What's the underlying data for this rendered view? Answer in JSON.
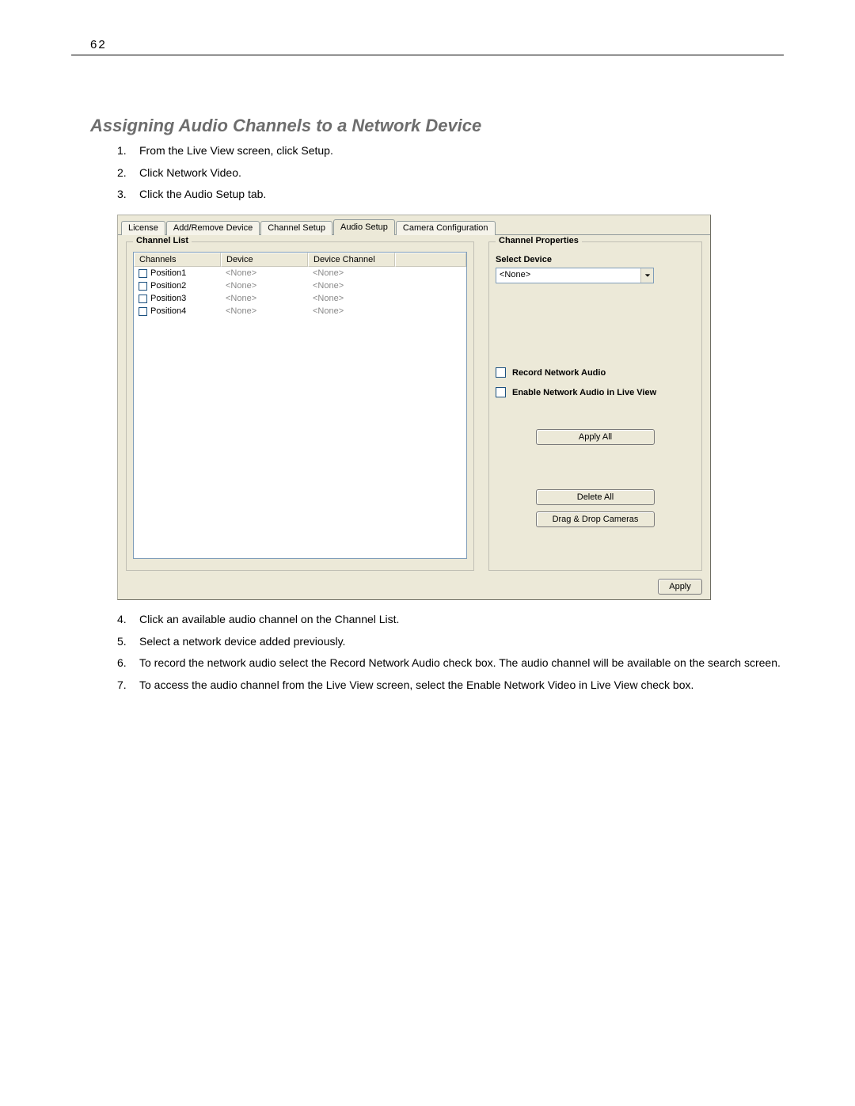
{
  "page_number": "62",
  "section_title": "Assigning Audio Channels to a Network Device",
  "steps_top": [
    "From the Live View screen, click Setup.",
    "Click Network Video.",
    "Click the Audio Setup tab."
  ],
  "steps_bottom": [
    "Click an available audio channel on the Channel List.",
    "Select a network device added previously.",
    "To record the network audio select the Record Network Audio check box. The audio channel will be available on the search screen.",
    "To access the audio channel from the Live View screen, select the Enable Network Video in Live View check box."
  ],
  "dialog": {
    "tabs": [
      "License",
      "Add/Remove Device",
      "Channel Setup",
      "Audio Setup",
      "Camera Configuration"
    ],
    "active_tab_index": 3,
    "channel_list": {
      "legend": "Channel List",
      "headers": [
        "Channels",
        "Device",
        "Device Channel"
      ],
      "rows": [
        {
          "name": "Position1",
          "device": "<None>",
          "dc": "<None>"
        },
        {
          "name": "Position2",
          "device": "<None>",
          "dc": "<None>"
        },
        {
          "name": "Position3",
          "device": "<None>",
          "dc": "<None>"
        },
        {
          "name": "Position4",
          "device": "<None>",
          "dc": "<None>"
        }
      ]
    },
    "channel_props": {
      "legend": "Channel Properties",
      "select_device_label": "Select Device",
      "select_device_value": "<None>",
      "check_record": "Record Network Audio",
      "check_live": "Enable Network Audio in Live View",
      "btn_apply_all": "Apply All",
      "btn_delete_all": "Delete All",
      "btn_dragdrop": "Drag & Drop Cameras"
    },
    "footer_apply": "Apply"
  }
}
